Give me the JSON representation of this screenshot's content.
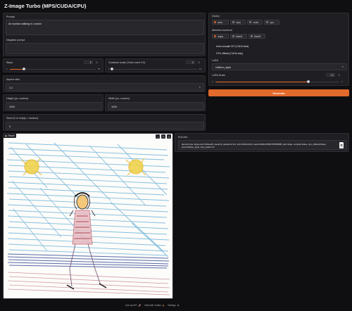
{
  "app": {
    "title": "Z-Image Turbo (MPS/CUDA/CPU)"
  },
  "left": {
    "prompt": {
      "label": "Prompt",
      "value": "An woman walking in London"
    },
    "negative": {
      "label": "Negative prompt",
      "value": ""
    },
    "steps": {
      "label": "Steps",
      "value": "9",
      "min": "1",
      "max": "50",
      "fraction": 0.16
    },
    "guidance": {
      "label": "Guidance scale (Turbo uses 0.0)",
      "value": "0",
      "min": "0",
      "max": "10",
      "fraction": 0.0
    },
    "aspect": {
      "label": "Aspect ratio",
      "value": "1:1"
    },
    "height": {
      "label": "Height (px, custom)",
      "value": "1024"
    },
    "width": {
      "label": "Width (px, custom)",
      "value": "1024"
    },
    "seed": {
      "label": "Seed (0 or empty = random)",
      "value": "0"
    }
  },
  "right": {
    "device": {
      "label": "Device",
      "options": [
        "auto",
        "mps",
        "cuda",
        "cpu"
      ],
      "selected": "auto"
    },
    "attention": {
      "label": "Attention backend",
      "options": [
        "sdpa",
        "flash2",
        "flash3"
      ],
      "selected": "sdpa"
    },
    "compile": {
      "label": "torch.compile DiT (CUDA best)"
    },
    "offload": {
      "label": "CPU offload (CUDA only)"
    },
    "lora": {
      "label": "LoRA",
      "value": "children_style"
    },
    "lora_scale": {
      "label": "LoRA Scale",
      "value": "1.5",
      "min": "0",
      "max": "2",
      "fraction": 0.75
    },
    "generate": {
      "label": "Generate"
    }
  },
  "result": {
    "tab_label": "Result",
    "run_info": {
      "label": "Run info",
      "value": "device=mps, dtype=torch.bfloat16, steps=9, guidance=0.0, size=1024x1024, seed=4264127820797803985, attn=sdpa, compile=False, cpu_offload=False, lora=children_style, lora_scale=1.5"
    }
  },
  "footer": {
    "api": "Use via API",
    "built": "Built with Gradio",
    "settings": "Settings"
  },
  "colors": {
    "accent": "#e8692b",
    "background": "#0f0f11",
    "panel": "#1f1f23"
  },
  "icons": [
    "image-icon",
    "download-icon",
    "share-icon",
    "copy-icon",
    "dropdown-chevron-icon",
    "rocket-icon",
    "gradio-logo-icon",
    "gear-icon"
  ]
}
